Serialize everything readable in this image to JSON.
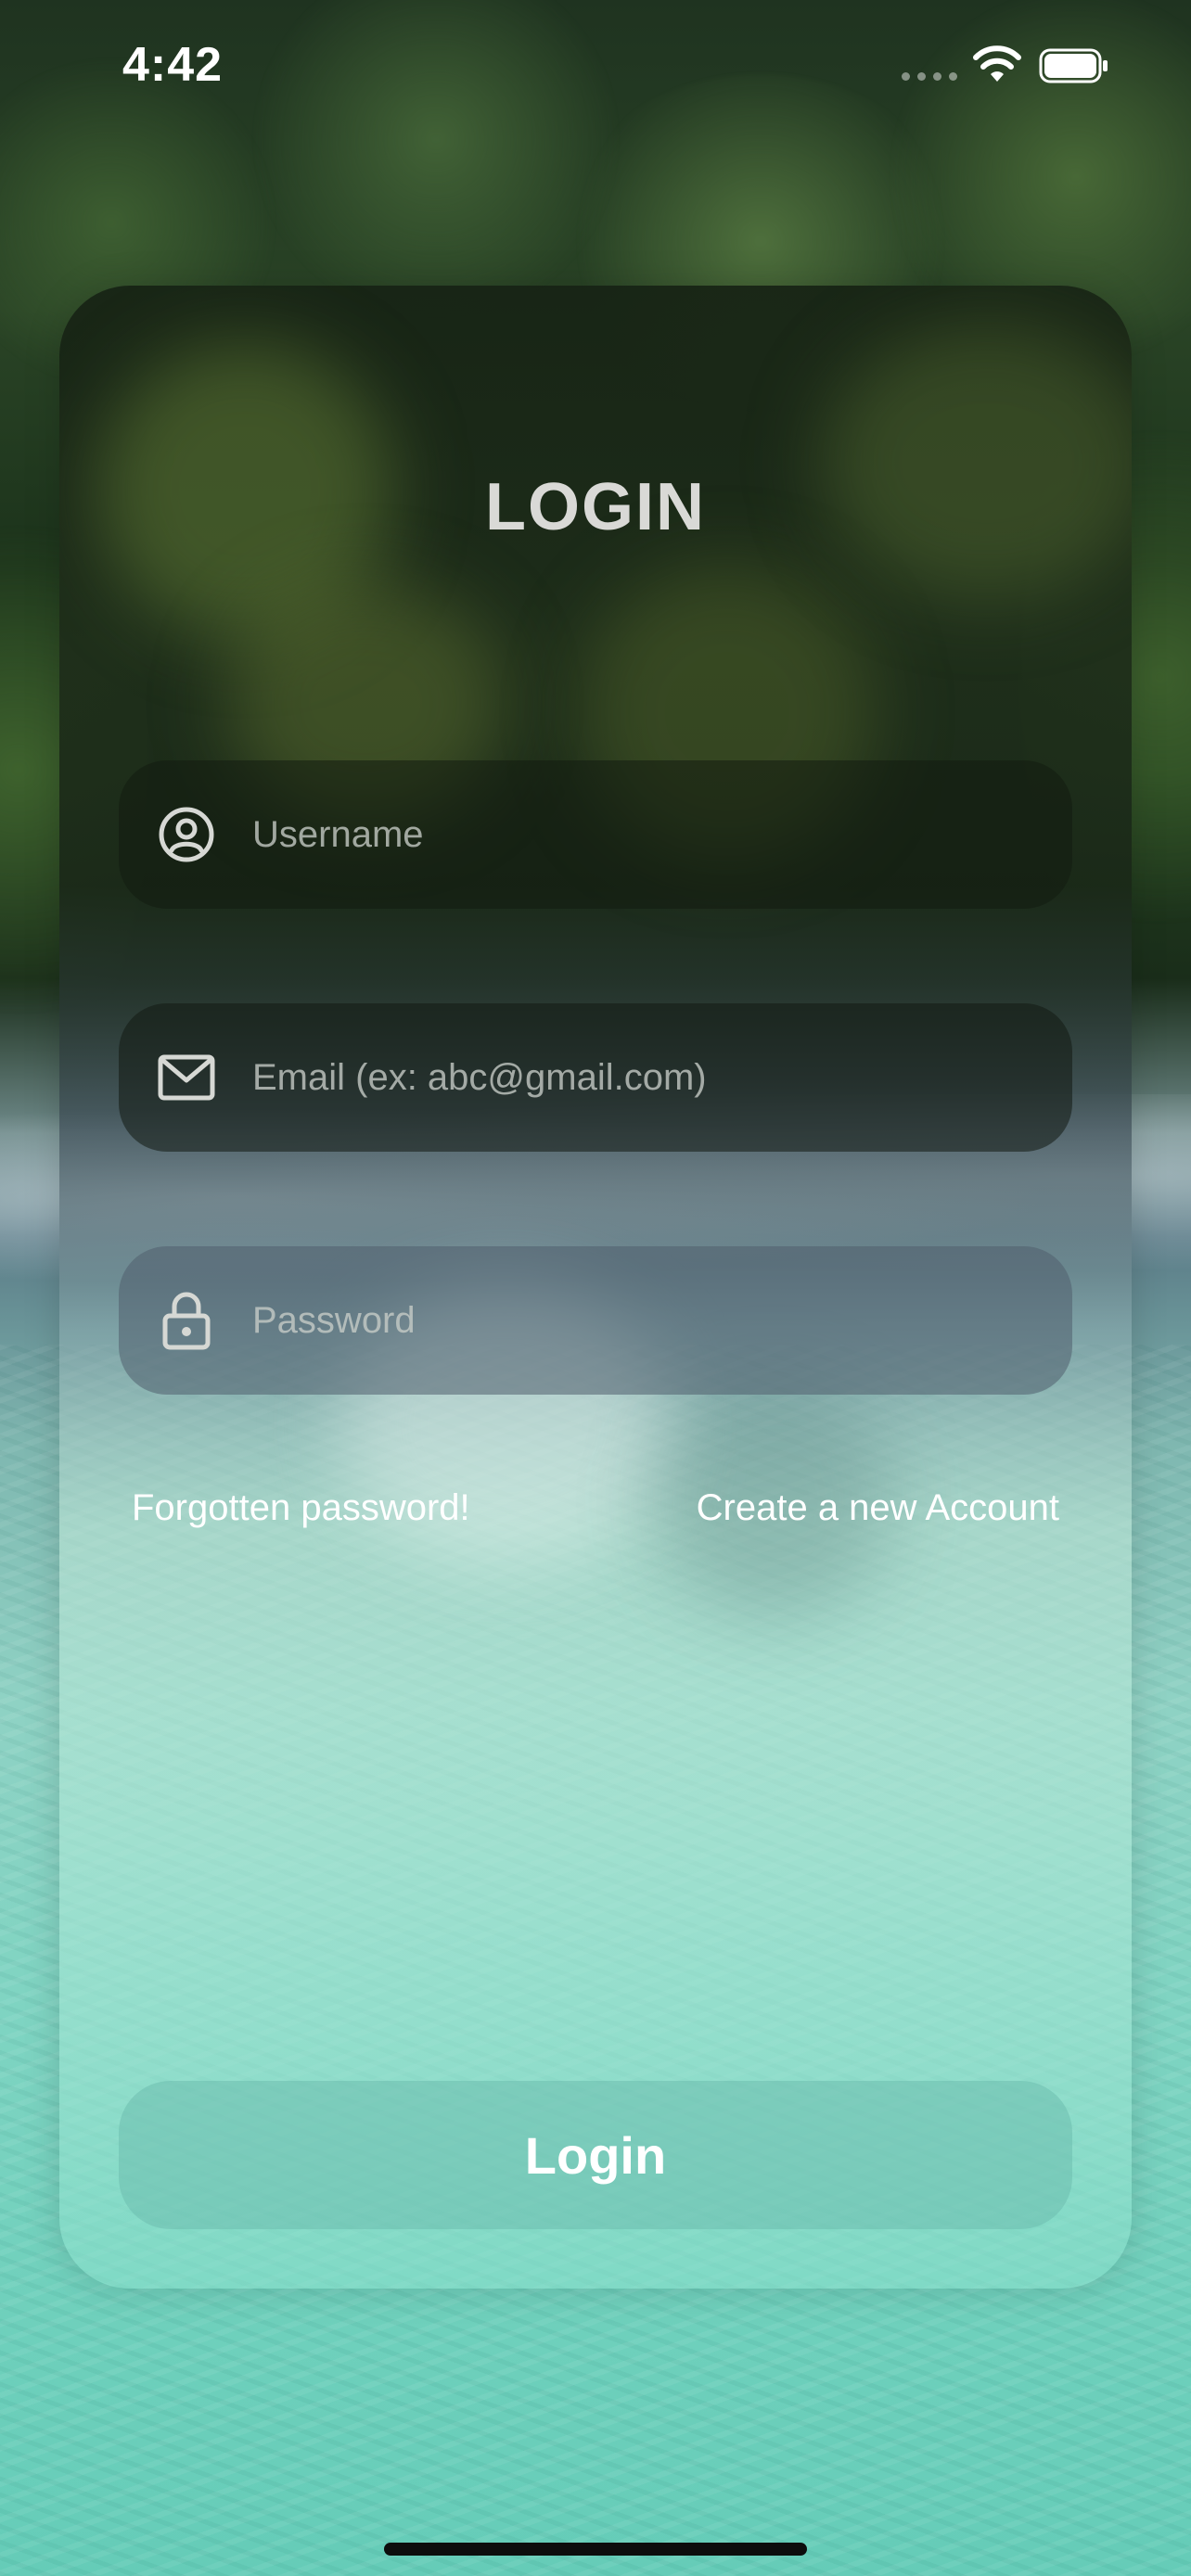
{
  "status_bar": {
    "time": "4:42"
  },
  "login_card": {
    "title": "LOGIN",
    "fields": {
      "username": {
        "placeholder": "Username",
        "value": "",
        "icon": "user-circle-icon"
      },
      "email": {
        "placeholder": "Email (ex: abc@gmail.com)",
        "value": "",
        "icon": "envelope-icon"
      },
      "password": {
        "placeholder": "Password",
        "value": "",
        "icon": "lock-icon"
      }
    },
    "links": {
      "forgot_password": "Forgotten password!",
      "create_account": "Create a new Account"
    },
    "login_button": "Login"
  },
  "colors": {
    "title_text": "#d9d9d6",
    "link_text": "#ffffff",
    "button_text": "#ffffff"
  }
}
